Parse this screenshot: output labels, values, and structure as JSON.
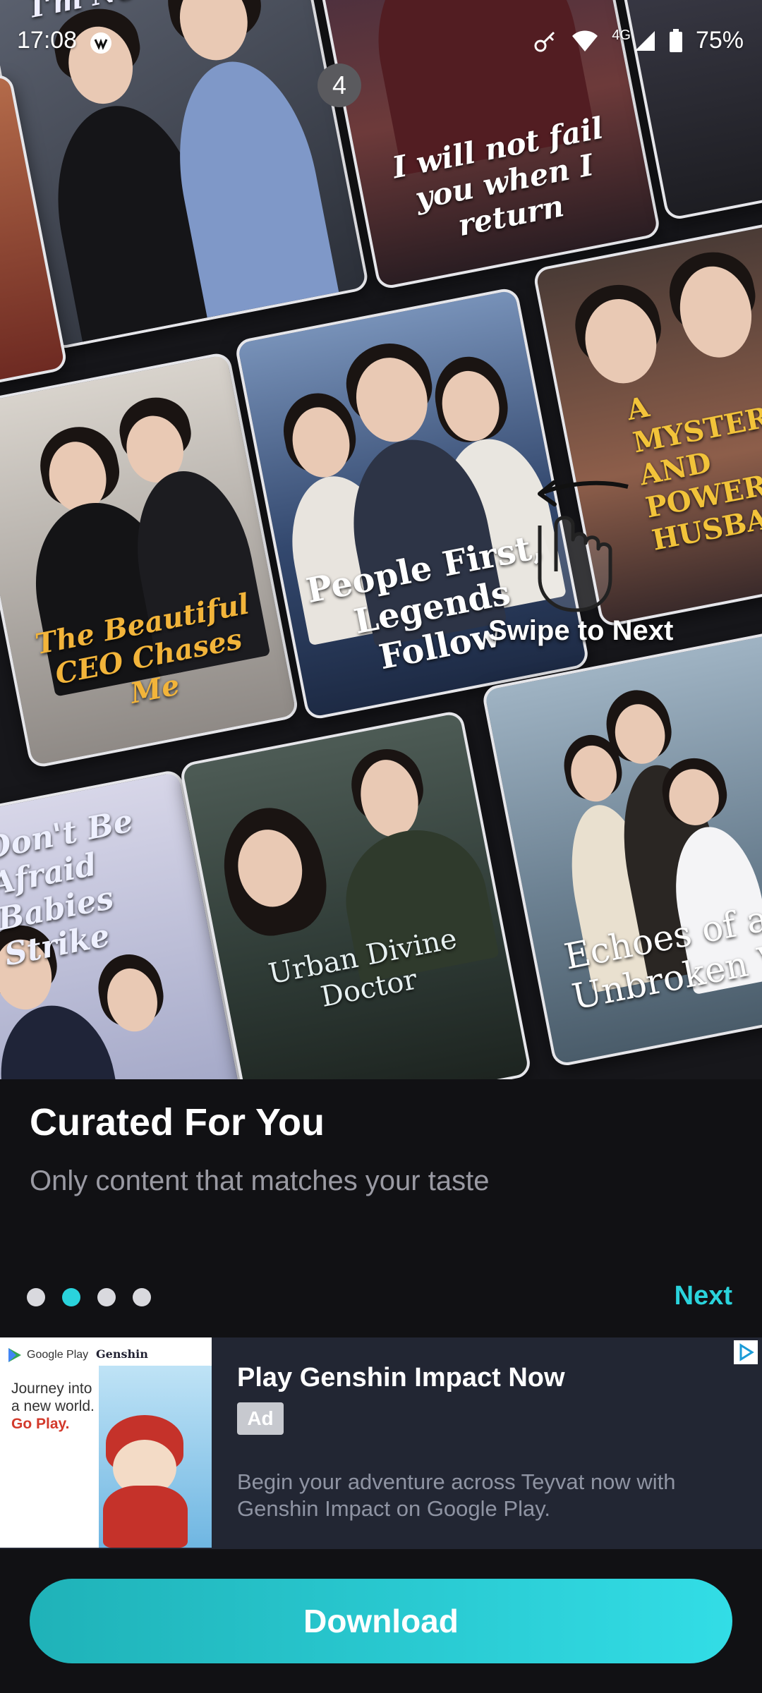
{
  "status_bar": {
    "time": "17:08",
    "network": "4G",
    "battery": "75%"
  },
  "badge": {
    "count": "4"
  },
  "posters": [
    {
      "title": "I'm No Nobody"
    },
    {
      "title": "I will not fail you when I return"
    },
    {
      "title": "The Beautiful CEO Chases Me"
    },
    {
      "title": "People First, Legends Follow"
    },
    {
      "title": "A MYSTERIOUS AND POWERFUL HUSBAND"
    },
    {
      "title": "Don't Be Afraid Babies Strike"
    },
    {
      "title": "Urban Divine Doctor"
    },
    {
      "title": "Echoes of an Unbroken Vow"
    }
  ],
  "overlay": {
    "swipe_hint": "Swipe to Next"
  },
  "onboarding": {
    "headline": "Curated For You",
    "subline": "Only content that matches your taste",
    "next_label": "Next",
    "page_index": 2,
    "page_count": 4
  },
  "ad": {
    "image": {
      "store": "Google Play",
      "brand": "Genshin",
      "tagline_1": "Journey into",
      "tagline_2": "a new world.",
      "tagline_3": "Go Play."
    },
    "title": "Play Genshin Impact Now",
    "label": "Ad",
    "description": "Begin your adventure across Teyvat now with Genshin Impact on Google Play."
  },
  "cta": {
    "download_label": "Download"
  },
  "colors": {
    "accent": "#2ad3dc",
    "background": "#111114",
    "ad_background": "#222633"
  }
}
